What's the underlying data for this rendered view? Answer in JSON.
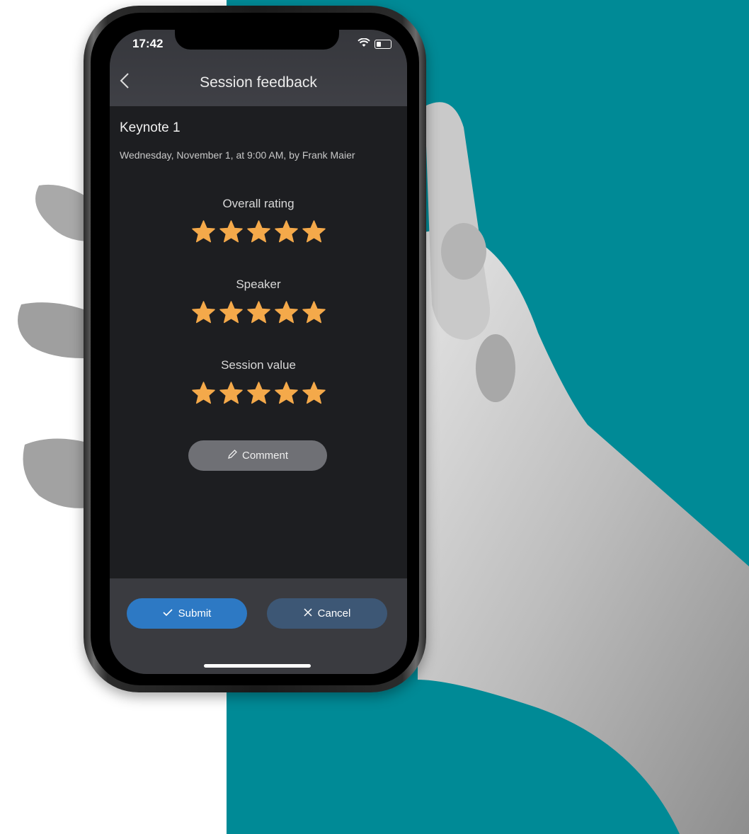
{
  "status_bar": {
    "time": "17:42"
  },
  "header": {
    "back_icon": "chevron-left-icon",
    "title": "Session feedback"
  },
  "session": {
    "name": "Keynote 1",
    "meta": "Wednesday, November 1, at 9:00 AM, by Frank Maier"
  },
  "ratings": [
    {
      "label": "Overall rating",
      "stars": 5,
      "max": 5
    },
    {
      "label": "Speaker",
      "stars": 5,
      "max": 5
    },
    {
      "label": "Session value",
      "stars": 5,
      "max": 5
    }
  ],
  "comment": {
    "label": "Comment",
    "icon": "pencil-icon"
  },
  "actions": {
    "submit_label": "Submit",
    "submit_icon": "checkmark-icon",
    "cancel_label": "Cancel",
    "cancel_icon": "close-icon"
  },
  "colors": {
    "background_teal": "#008a96",
    "star": "#f4a94a",
    "submit": "#2d79c4",
    "cancel": "#3d5775"
  }
}
